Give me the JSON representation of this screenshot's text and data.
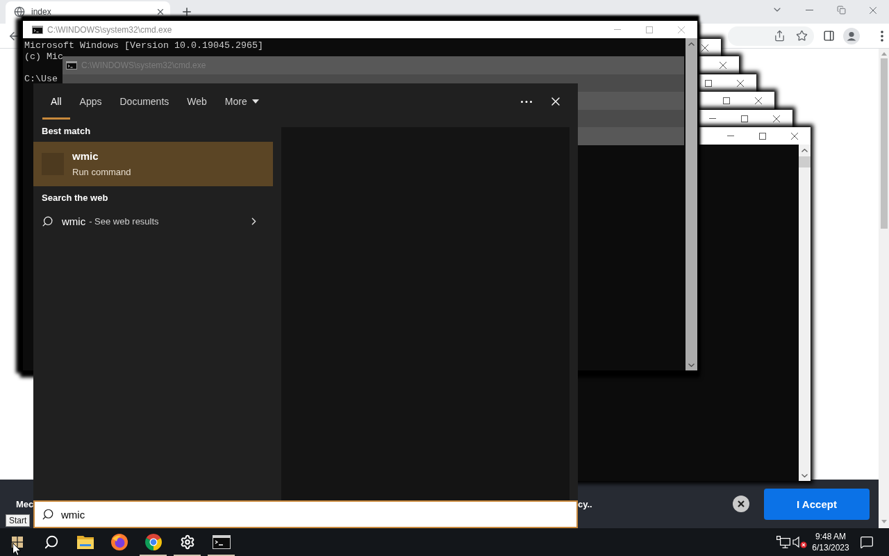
{
  "browser": {
    "tabs": [
      {
        "title": "index",
        "selected": true
      }
    ],
    "cookie_banner": {
      "text_start": "Mec",
      "text_end": "cy..",
      "accept_button": "I Accept"
    }
  },
  "cmd_windows": {
    "main": {
      "title": "C:\\WINDOWS\\system32\\cmd.exe",
      "paragraphs": [
        [
          "Microsoft Windows [Version 10.0.19045.2965]",
          "(c) Mic"
        ],
        [
          "C:\\Use"
        ]
      ]
    },
    "cascade": [
      {
        "ghost": false
      },
      {
        "ghost": true,
        "ghost_title": "C:\\WINDOWS\\system32\\cmd.exe"
      },
      {
        "ghost": true
      },
      {
        "ghost": true
      },
      {
        "ghost": true
      },
      {
        "ghost": true
      }
    ]
  },
  "search_flyout": {
    "tabs": [
      {
        "label": "All",
        "selected": true,
        "kind": "plain"
      },
      {
        "label": "Apps",
        "selected": false,
        "kind": "plain"
      },
      {
        "label": "Documents",
        "selected": false,
        "kind": "plain"
      },
      {
        "label": "Web",
        "selected": false,
        "kind": "plain"
      },
      {
        "label": "More",
        "selected": false,
        "kind": "menu"
      }
    ],
    "sections": [
      {
        "heading": "Best match",
        "results": [
          {
            "kind": "app",
            "title": "wmic",
            "subtitle": "Run command",
            "selected": true
          }
        ]
      },
      {
        "heading": "Search the web",
        "results": [
          {
            "kind": "web",
            "title": "wmic",
            "subtitle": "- See web results",
            "selected": false
          }
        ]
      }
    ],
    "search_box": {
      "value": "wmic"
    }
  },
  "taskbar": {
    "start": {
      "tooltip": "Start"
    },
    "apps": [
      {
        "kind": "search",
        "running": false
      },
      {
        "kind": "file-explorer",
        "running": false
      },
      {
        "kind": "firefox",
        "running": false
      },
      {
        "kind": "chrome",
        "running": true
      },
      {
        "kind": "settings",
        "running": true
      },
      {
        "kind": "terminal",
        "running": true
      }
    ],
    "tray": [
      {
        "kind": "network"
      },
      {
        "kind": "volume",
        "muted": true
      }
    ],
    "clock": {
      "time": "9:48 AM",
      "date": "6/13/2023"
    }
  }
}
